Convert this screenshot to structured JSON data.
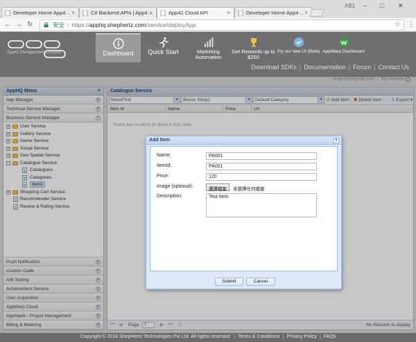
{
  "browser": {
    "tabs": [
      {
        "title": "Developer Home App4…",
        "active": false
      },
      {
        "title": "C# Backend APIs | App4…",
        "active": false
      },
      {
        "title": "App42 Cloud API",
        "active": true
      },
      {
        "title": "Developer Home App4…",
        "active": false
      }
    ],
    "user_label": "AB1",
    "address": {
      "secure_label": "安全",
      "scheme": "https://",
      "host": "apphq.shephertz.com",
      "path": "/service/deployApp"
    }
  },
  "header": {
    "logo_text": "APP HQ",
    "console_label": "App42 Management Console",
    "nav": [
      {
        "label": "Dashboard",
        "icon": "info-icon"
      },
      {
        "label": "Quick Start",
        "icon": "runner-icon"
      },
      {
        "label": "Marketing Automation",
        "icon": "bar-chart-icon"
      },
      {
        "label": "Get Rewards up to $200",
        "icon": "trophy-icon"
      },
      {
        "label": "Try our new UI (Beta)",
        "icon": "beta-icon"
      },
      {
        "label": "AppWarp Dashboard",
        "icon": "appwarp-icon"
      }
    ],
    "links": [
      "Download SDKs",
      "Documentation",
      "Forum",
      "Contact Us"
    ]
  },
  "user": {
    "email": "tangshul@gmail.com",
    "account_label": "My Account"
  },
  "sidebar": {
    "title": "AppHQ Menu",
    "top_items": [
      "App Manager",
      "Technical Service Manager",
      "Business Service Manager"
    ],
    "tree": [
      {
        "label": "User Service",
        "level": 0,
        "type": "folder",
        "expander": "+"
      },
      {
        "label": "Gallery Service",
        "level": 0,
        "type": "folder",
        "expander": "+"
      },
      {
        "label": "Game Service",
        "level": 0,
        "type": "folder",
        "expander": "+"
      },
      {
        "label": "Social Service",
        "level": 0,
        "type": "folder",
        "expander": "+"
      },
      {
        "label": "Geo Spatial Service",
        "level": 0,
        "type": "folder",
        "expander": "+"
      },
      {
        "label": "Catalogue Service",
        "level": 0,
        "type": "folder",
        "expander": "-"
      },
      {
        "label": "Catalogues",
        "level": 1,
        "type": "leaf",
        "expander": ""
      },
      {
        "label": "Categories",
        "level": 1,
        "type": "leaf",
        "expander": ""
      },
      {
        "label": "Items",
        "level": 1,
        "type": "leaf",
        "expander": "",
        "selected": true
      },
      {
        "label": "Shopping Cart Service",
        "level": 0,
        "type": "folder",
        "expander": "+"
      },
      {
        "label": "Recommender Service",
        "level": 0,
        "type": "leaf",
        "expander": ""
      },
      {
        "label": "Review & Rating Service",
        "level": 0,
        "type": "leaf",
        "expander": ""
      }
    ],
    "bottom_items": [
      "Push Notification",
      "Custom Code",
      "A/B Testing",
      "Achievement Service",
      "User Acquisition",
      "AppWarp Cloud",
      "AppHawk - Project Management",
      "Billing & Metering"
    ]
  },
  "main": {
    "title": "Catalogue Service",
    "combos": [
      "MoveFirst",
      "Bonus Shop2",
      "Default Category"
    ],
    "add_label": "Add Item",
    "delete_label": "Delete Item",
    "export_label": "Export",
    "columns": [
      "Item Id",
      "Name",
      "Price",
      "Url"
    ],
    "empty_text": "There are no items to show in this view.",
    "pager": {
      "page_label": "Page",
      "page_value": "1",
      "status": "No Records to display"
    }
  },
  "dialog": {
    "title": "Add Item",
    "fields": {
      "name_label": "Name:",
      "name_value": "PA001",
      "itemid_label": "ItemId:",
      "itemid_value": "PA001",
      "price_label": "Price:",
      "price_value": "120",
      "image_label": "Image (optional):",
      "file_button": "選擇檔案",
      "file_status": "未選擇任何檔案",
      "desc_label": "Description:",
      "desc_value": "Test Item"
    },
    "submit_label": "Submit",
    "cancel_label": "Cancel"
  },
  "footer": {
    "copyright": "Copyright © 2018 ShepHertz Technologies Pvt Ltd. All rights reserved.",
    "links": [
      "Terms & Conditions",
      "Privacy Policy",
      "FAQs"
    ]
  }
}
